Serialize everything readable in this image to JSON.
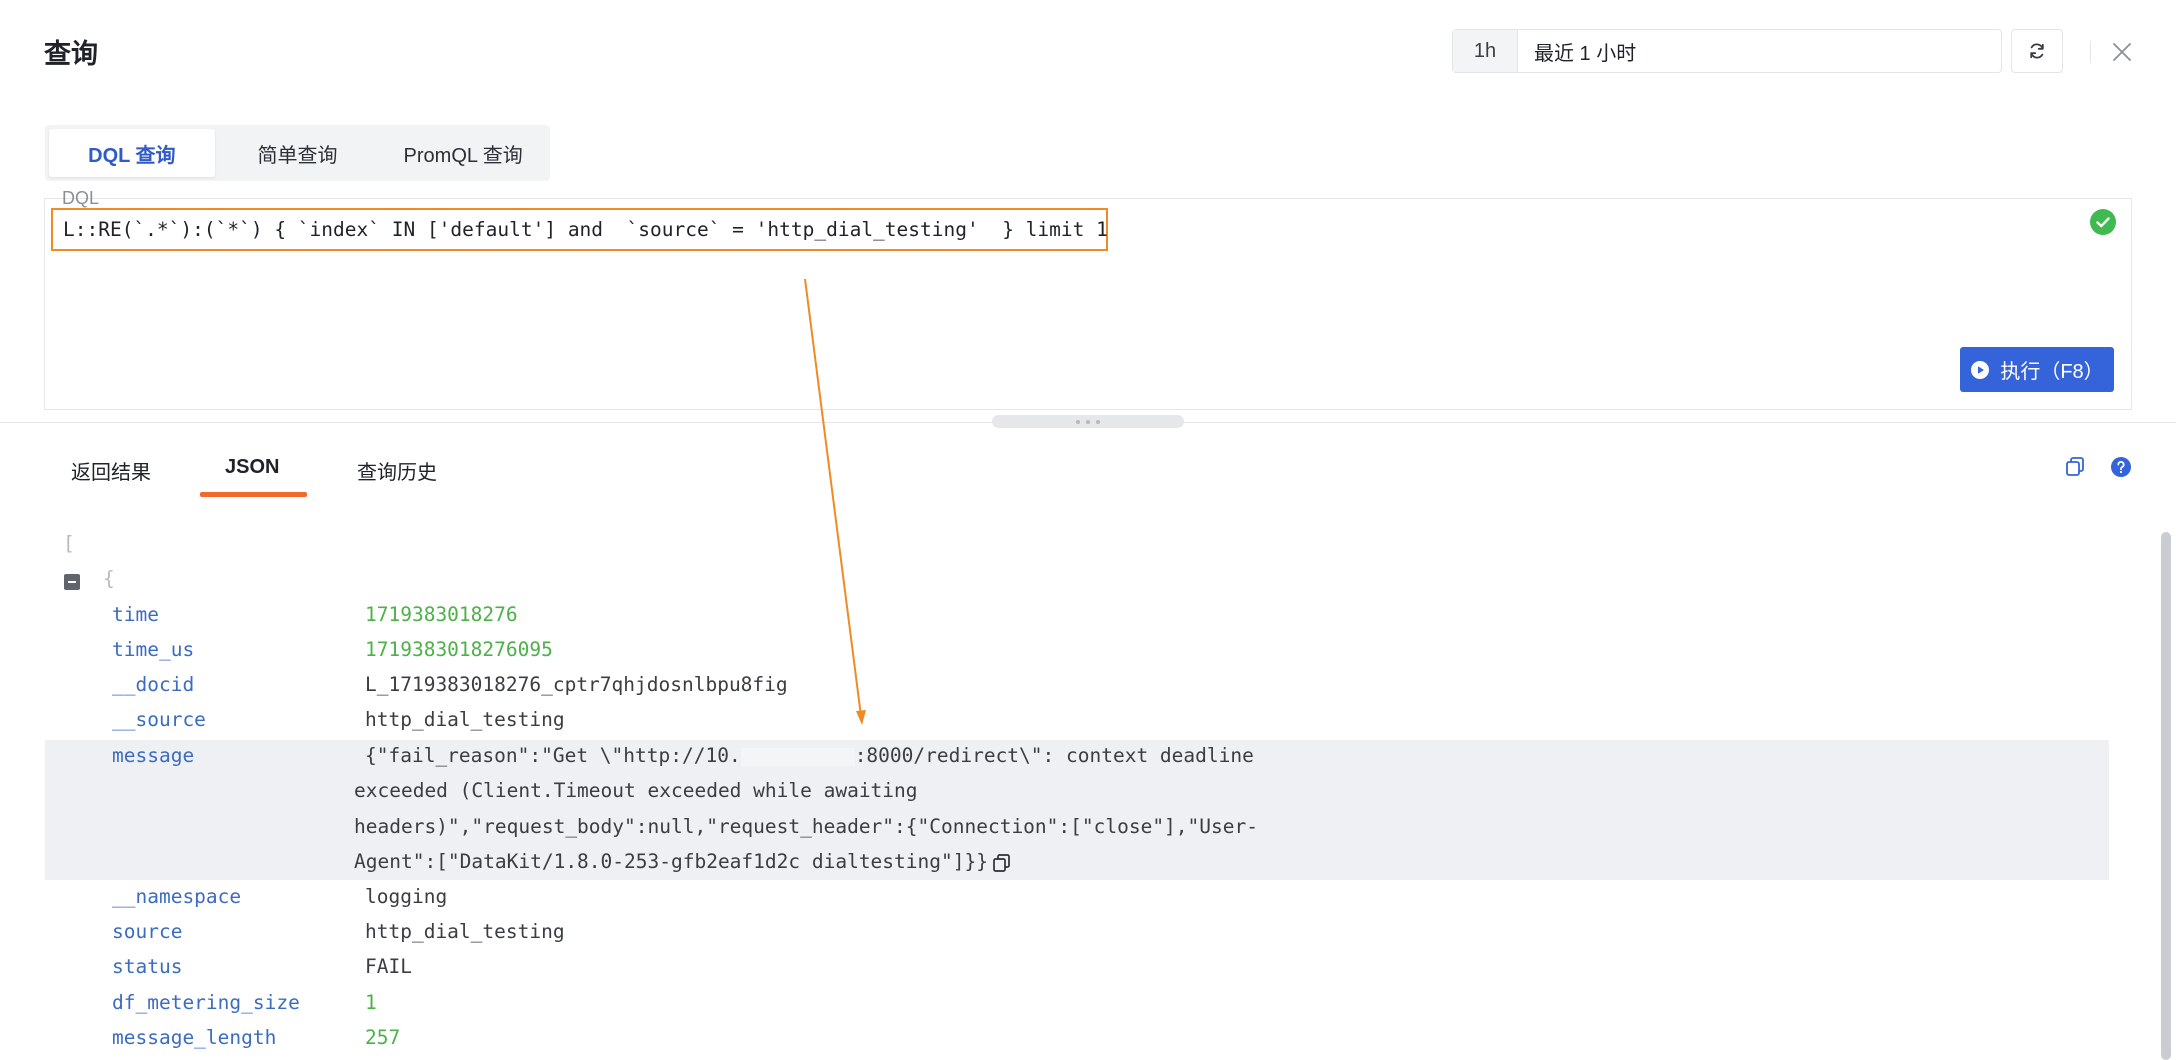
{
  "header": {
    "title": "查询",
    "time_chip": "1h",
    "time_range_label": "最近 1 小时"
  },
  "query_tabs": [
    {
      "label": "DQL 查询",
      "active": true
    },
    {
      "label": "简单查询",
      "active": false
    },
    {
      "label": "PromQL 查询",
      "active": false
    }
  ],
  "editor": {
    "label": "DQL",
    "query": "L::RE(`.*`):(`*`) { `index` IN ['default'] and  `source` = 'http_dial_testing'  } limit 1",
    "run_button": "执行（F8）"
  },
  "result_tabs": [
    {
      "label": "返回结果",
      "active": false
    },
    {
      "label": "JSON",
      "active": true
    },
    {
      "label": "查询历史",
      "active": false
    }
  ],
  "json_view": {
    "open_bracket": "[",
    "open_brace": "{",
    "fields": [
      {
        "key": "time",
        "value": "1719383018276",
        "type": "number"
      },
      {
        "key": "time_us",
        "value": "1719383018276095",
        "type": "number"
      },
      {
        "key": "__docid",
        "value": "L_1719383018276_cptr7qhjdosnlbpu8fig",
        "type": "string"
      },
      {
        "key": "__source",
        "value": "http_dial_testing",
        "type": "string"
      },
      {
        "key": "message",
        "type": "string",
        "highlighted": true,
        "lines": [
          "{\"fail_reason\":\"Get \\\"http://10.",
          ":8000/redirect\\\": context deadline",
          "exceeded (Client.Timeout exceeded while awaiting",
          "headers)\",\"request_body\":null,\"request_header\":{\"Connection\":[\"close\"],\"User-",
          "Agent\":[\"DataKit/1.8.0-253-gfb2eaf1d2c dialtesting\"]}}"
        ]
      },
      {
        "key": "__namespace",
        "value": "logging",
        "type": "string"
      },
      {
        "key": "source",
        "value": "http_dial_testing",
        "type": "string"
      },
      {
        "key": "status",
        "value": "FAIL",
        "type": "string"
      },
      {
        "key": "df_metering_size",
        "value": "1",
        "type": "number"
      },
      {
        "key": "message_length",
        "value": "257",
        "type": "number"
      }
    ]
  },
  "colors": {
    "accent": "#3563d9",
    "tab_underline": "#f06a2c",
    "annotation": "#f08a24",
    "json_key": "#3b6cc0",
    "json_number": "#4db048",
    "success": "#3fb950"
  },
  "icons": {
    "refresh": "refresh-icon",
    "close": "close-icon",
    "valid": "check-circle-icon",
    "play": "play-circle-icon",
    "copy": "copy-icon",
    "help": "help-icon",
    "collapse": "collapse-icon"
  }
}
